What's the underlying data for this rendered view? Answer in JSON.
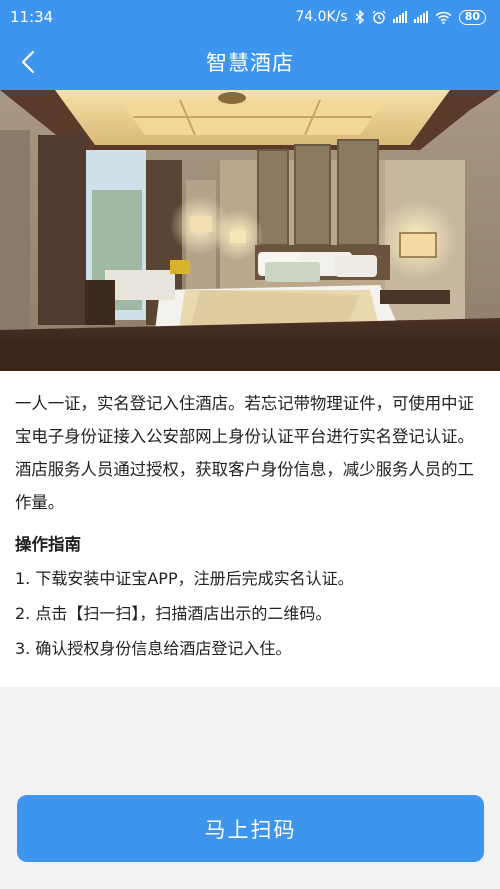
{
  "status_bar": {
    "time": "11:34",
    "network_speed": "74.0K/s",
    "battery": "80"
  },
  "nav": {
    "title": "智慧酒店"
  },
  "hero": {
    "image": "hotel-room-photo"
  },
  "content": {
    "description": "一人一证，实名登记入住酒店。若忘记带物理证件，可使用中证宝电子身份证接入公安部网上身份认证平台进行实名登记认证。酒店服务人员通过授权，获取客户身份信息，减少服务人员的工作量。",
    "guide_title": "操作指南",
    "steps": [
      "1. 下载安装中证宝APP，注册后完成实名认证。",
      "2. 点击【扫一扫】，扫描酒店出示的二维码。",
      "3. 确认授权身份信息给酒店登记入住。"
    ]
  },
  "action": {
    "scan_label": "马上扫码"
  },
  "colors": {
    "primary": "#3d95ee",
    "background": "#f2f2f2",
    "text": "#222222"
  }
}
